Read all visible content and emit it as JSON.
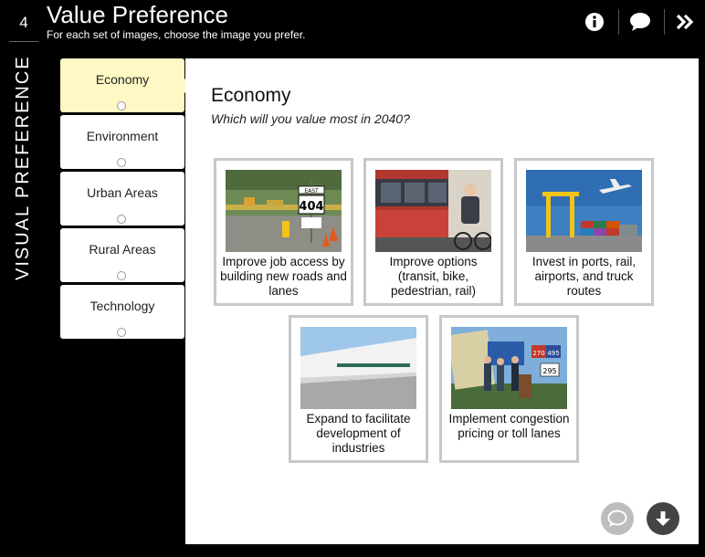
{
  "header": {
    "step_number": "4",
    "title": "Value Preference",
    "subtitle": "For each set of images, choose the image you prefer.",
    "buttons": [
      "info-icon",
      "comment-icon",
      "next-icon"
    ]
  },
  "sidebar_label": "VISUAL PREFERENCE",
  "tabs": [
    {
      "label": "Economy",
      "active": true
    },
    {
      "label": "Environment"
    },
    {
      "label": "Urban Areas"
    },
    {
      "label": "Rural Areas"
    },
    {
      "label": "Technology"
    }
  ],
  "panel": {
    "title": "Economy",
    "question": "Which will you value most in 2040?"
  },
  "options": [
    {
      "label": "Improve job access by building new roads and lanes",
      "image": "highway-construction-image",
      "sign_top": "EAST",
      "sign_mid": "404"
    },
    {
      "label": "Improve options (transit, bike, pedestrian, rail)",
      "image": "cyclist-bus-image"
    },
    {
      "label": "Invest in ports, rail, airports, and truck routes",
      "image": "port-airplane-image"
    },
    {
      "label": "Expand to facilitate development of industries",
      "image": "warehouse-image"
    },
    {
      "label": "Implement congestion pricing or toll lanes",
      "image": "press-conference-image",
      "sign_a": "270",
      "sign_b": "495",
      "sign_c": "295"
    }
  ],
  "colors": {
    "active_tab": "#fdf8c4",
    "card_border": "#c8c8c8",
    "fab_comment": "#bdbdbd",
    "fab_download": "#444444"
  }
}
